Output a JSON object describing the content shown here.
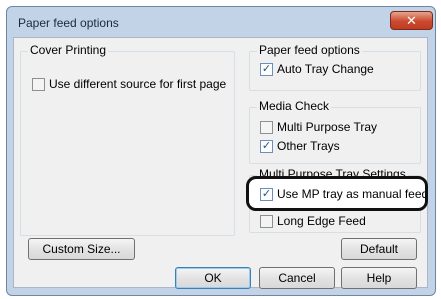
{
  "dialog": {
    "title": "Paper feed options",
    "close_symbol": "✕"
  },
  "cover_printing": {
    "label": "Cover Printing",
    "use_different_source": {
      "label": "Use different source for first page",
      "checked": false
    }
  },
  "paper_feed_options": {
    "label": "Paper feed options",
    "auto_tray_change": {
      "label": "Auto Tray Change",
      "checked": true
    }
  },
  "media_check": {
    "label": "Media Check",
    "multi_purpose_tray": {
      "label": "Multi Purpose Tray",
      "checked": false
    },
    "other_trays": {
      "label": "Other Trays",
      "checked": true
    }
  },
  "multi_purpose_tray_settings": {
    "label": "Multi Purpose Tray Settings",
    "use_mp_tray_manual_feed": {
      "label": "Use MP tray as manual feed",
      "checked": true
    },
    "long_edge_feed": {
      "label": "Long Edge Feed",
      "checked": false
    }
  },
  "buttons": {
    "custom_size": "Custom Size...",
    "default": "Default",
    "ok": "OK",
    "cancel": "Cancel",
    "help": "Help"
  },
  "icons": {
    "check": "check-icon",
    "close": "close-icon"
  }
}
